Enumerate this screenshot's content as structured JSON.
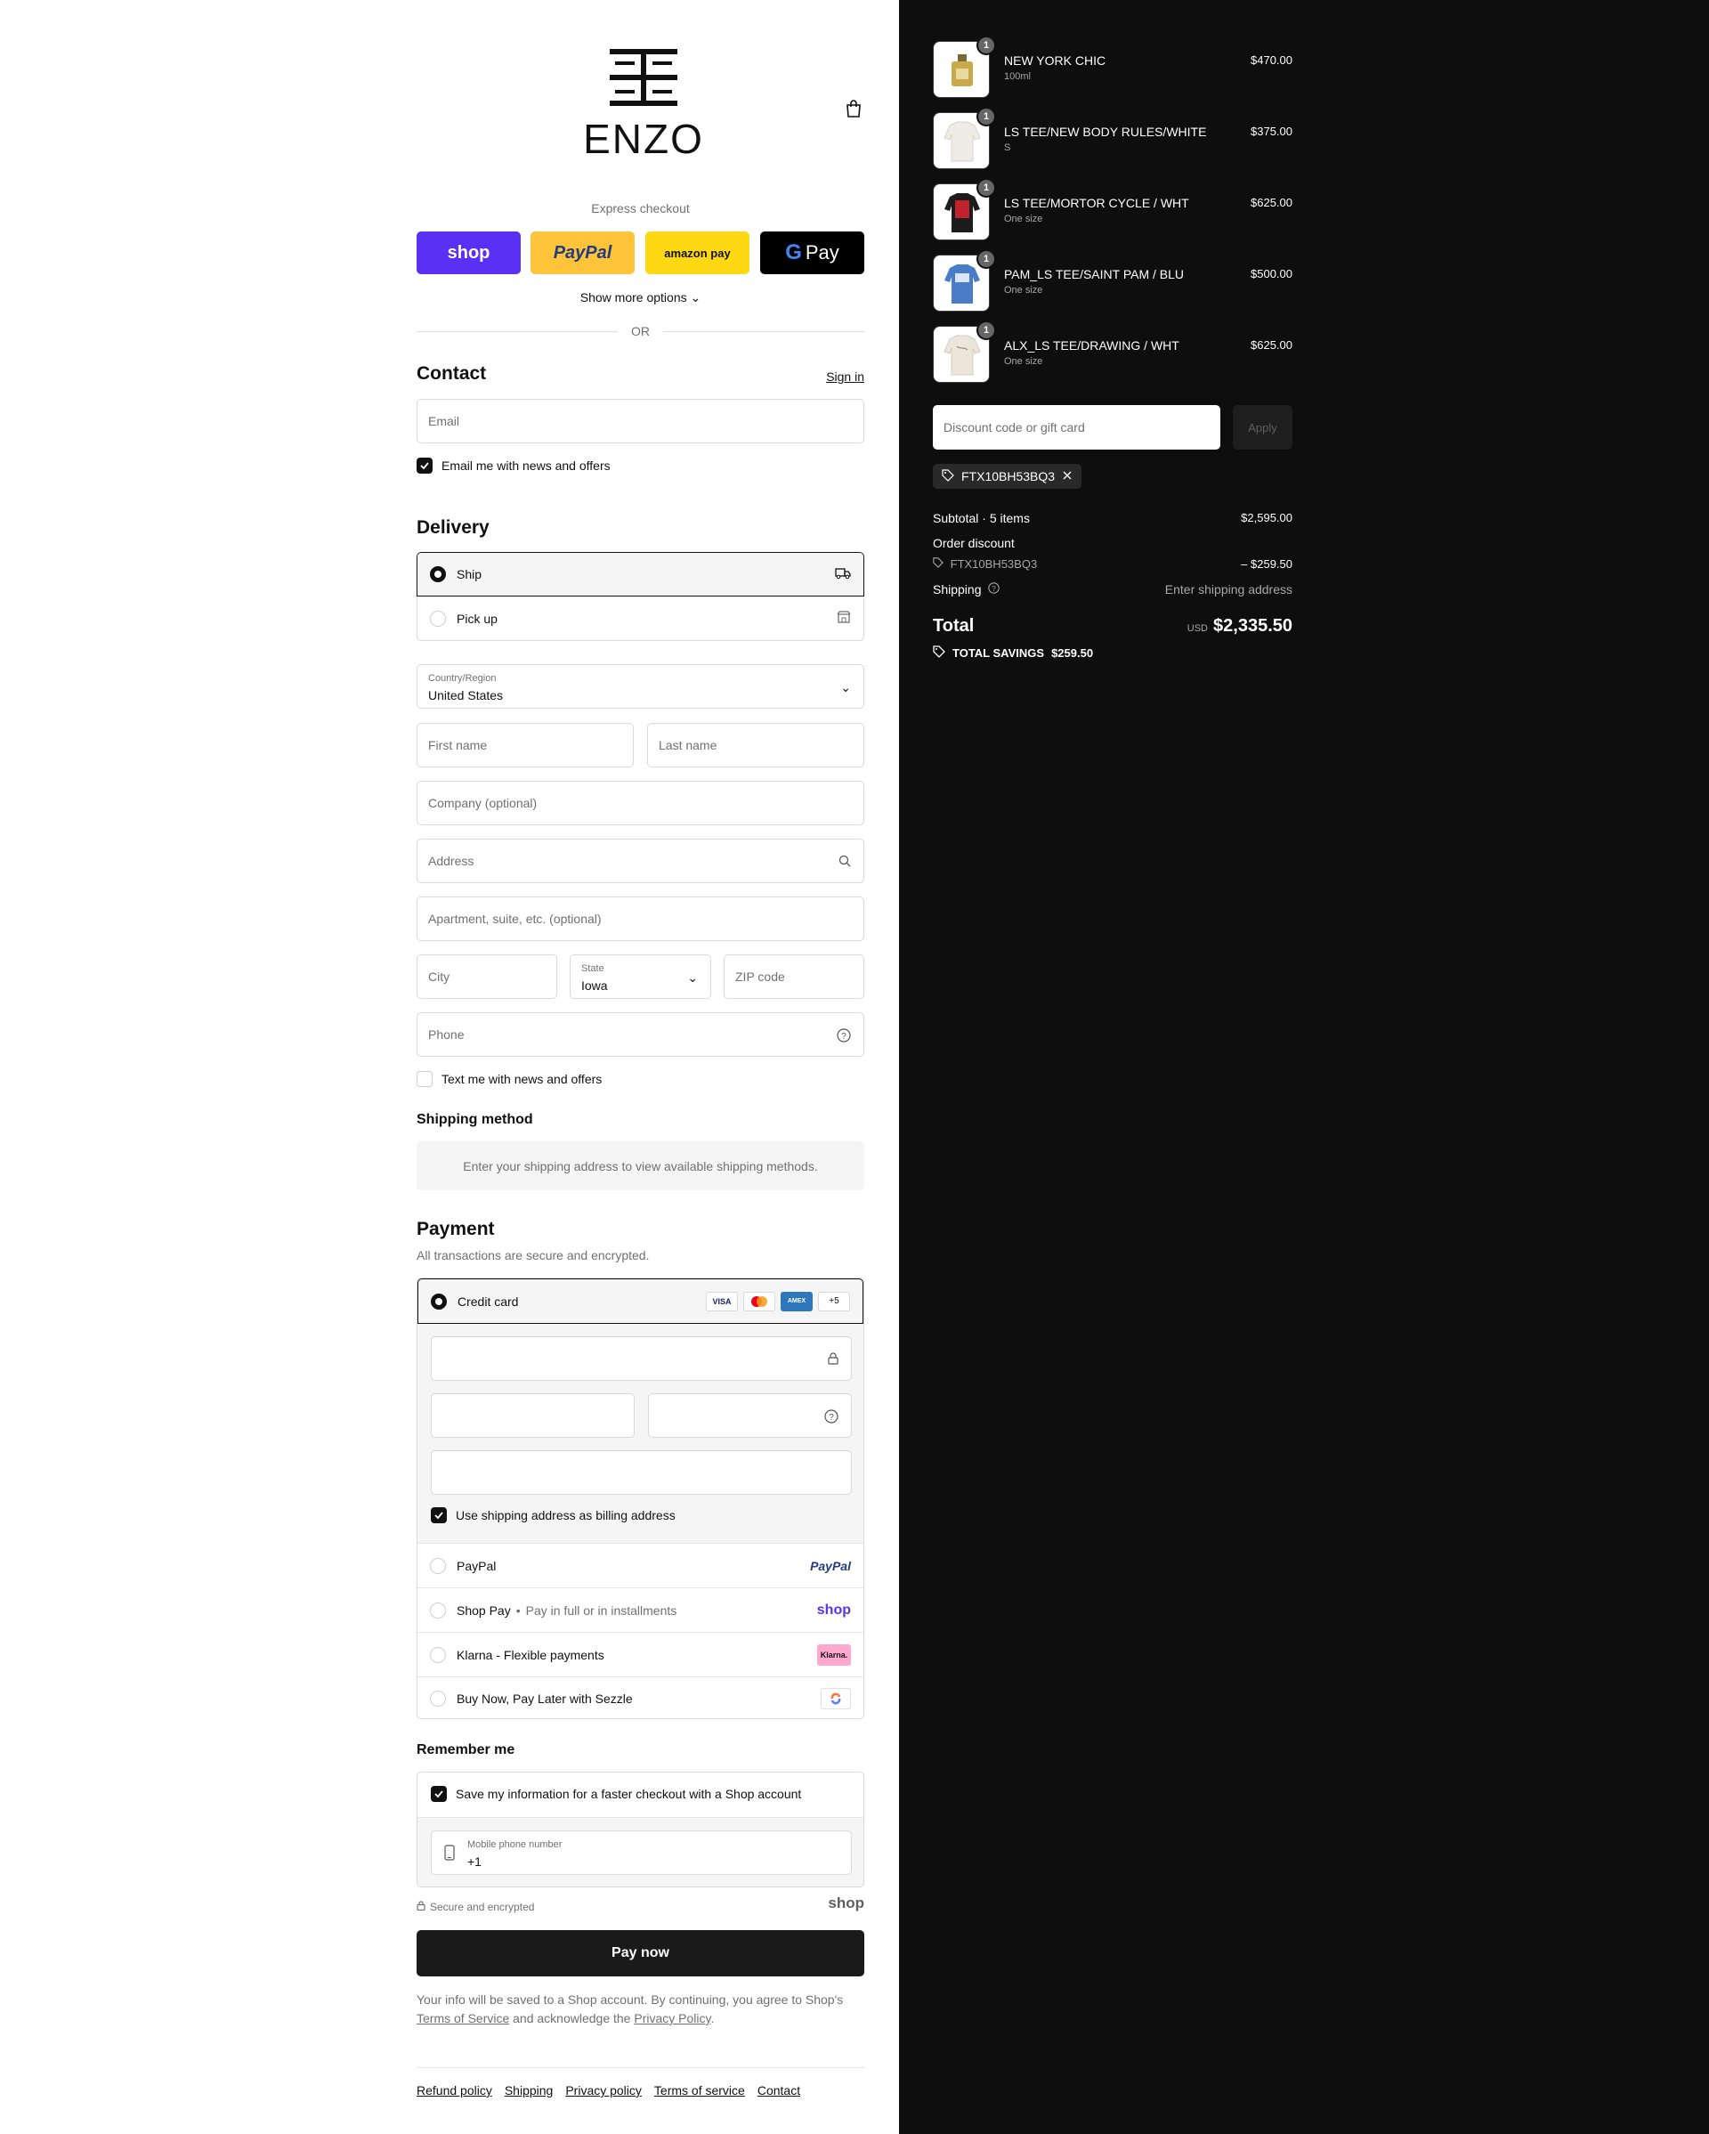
{
  "brand": {
    "logo_text": "ENZO"
  },
  "express": {
    "title": "Express checkout",
    "buttons": {
      "shop": "shop",
      "paypal": "PayPal",
      "amazon": "amazon pay",
      "gpay": "Pay"
    },
    "show_more": "Show more options",
    "or": "OR"
  },
  "contact": {
    "heading": "Contact",
    "sign_in": "Sign in",
    "email_placeholder": "Email",
    "news_label": "Email me with news and offers"
  },
  "delivery": {
    "heading": "Delivery",
    "options": [
      {
        "label": "Ship",
        "selected": true
      },
      {
        "label": "Pick up",
        "selected": false
      }
    ],
    "country_label": "Country/Region",
    "country_value": "United States",
    "first_name": "First name",
    "last_name": "Last name",
    "company": "Company (optional)",
    "address": "Address",
    "apartment": "Apartment, suite, etc. (optional)",
    "city": "City",
    "state_label": "State",
    "state_value": "Iowa",
    "zip": "ZIP code",
    "phone": "Phone",
    "text_label": "Text me with news and offers"
  },
  "shipping_method": {
    "heading": "Shipping method",
    "notice": "Enter your shipping address to view available shipping methods."
  },
  "payment": {
    "heading": "Payment",
    "subtitle": "All transactions are secure and encrypted.",
    "credit_card": "Credit card",
    "cards": [
      "VISA",
      "MC",
      "AMEX",
      "+5"
    ],
    "billing_label": "Use shipping address as billing address",
    "paypal": "PayPal",
    "paypal_logo": "PayPal",
    "shop_pay": "Shop Pay",
    "shop_pay_sub": "Pay in full or in installments",
    "shop_logo": "shop",
    "klarna": "Klarna - Flexible payments",
    "klarna_logo": "Klarna.",
    "sezzle": "Buy Now, Pay Later with Sezzle"
  },
  "remember": {
    "heading": "Remember me",
    "save_label": "Save my information for a faster checkout with a Shop account",
    "mobile_label": "Mobile phone number",
    "mobile_value": "+1",
    "secure": "Secure and encrypted",
    "shop_logo": "shop"
  },
  "pay_now": "Pay now",
  "legal": {
    "text1": "Your info will be saved to a Shop account. By continuing, you agree to Shop's",
    "tos": "Terms of Service",
    "and": "and acknowledge the",
    "privacy": "Privacy Policy",
    "period": "."
  },
  "footer": [
    "Refund policy",
    "Shipping",
    "Privacy policy",
    "Terms of service",
    "Contact"
  ],
  "cart": {
    "items": [
      {
        "name": "NEW YORK CHIC",
        "variant": "100ml",
        "price": "$470.00",
        "qty": "1"
      },
      {
        "name": "LS TEE/NEW BODY RULES/WHITE",
        "variant": "S",
        "price": "$375.00",
        "qty": "1"
      },
      {
        "name": "LS TEE/MORTOR CYCLE / WHT",
        "variant": "One size",
        "price": "$625.00",
        "qty": "1"
      },
      {
        "name": "PAM_LS TEE/SAINT PAM / BLU",
        "variant": "One size",
        "price": "$500.00",
        "qty": "1"
      },
      {
        "name": "ALX_LS TEE/DRAWING / WHT",
        "variant": "One size",
        "price": "$625.00",
        "qty": "1"
      }
    ],
    "discount_placeholder": "Discount code or gift card",
    "apply": "Apply",
    "code": "FTX10BH53BQ3",
    "subtotal_label": "Subtotal · 5 items",
    "subtotal": "$2,595.00",
    "order_discount": "Order discount",
    "discount_amount": "– $259.50",
    "shipping_label": "Shipping",
    "shipping_value": "Enter shipping address",
    "total_label": "Total",
    "currency": "USD",
    "total": "$2,335.50",
    "savings_label": "TOTAL SAVINGS",
    "savings": "$259.50"
  }
}
